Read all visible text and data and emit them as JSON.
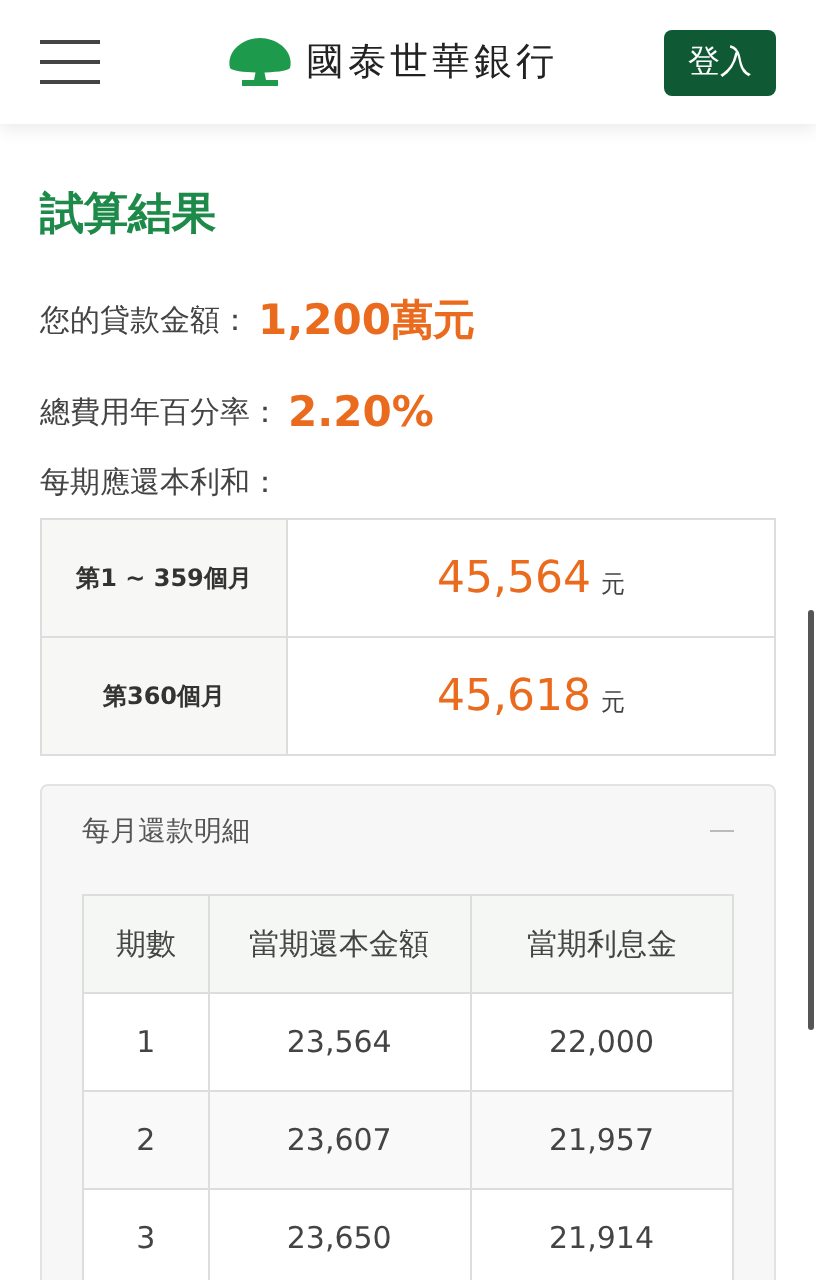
{
  "header": {
    "brand": "國泰世華銀行",
    "login_button": "登入"
  },
  "title": "試算結果",
  "summary": [
    {
      "label": "您的貸款金額：",
      "value": "1,200萬元"
    },
    {
      "label": "總費用年百分率：",
      "value": "2.20%"
    }
  ],
  "payment_label": "每期應還本利和：",
  "payments": [
    {
      "period": "第1 ~ 359個月",
      "amount": "45,564",
      "unit": "元"
    },
    {
      "period": "第360個月",
      "amount": "45,618",
      "unit": "元"
    }
  ],
  "detail_panel": {
    "title": "每月還款明細",
    "expanded": true,
    "columns": [
      "期數",
      "當期還本金額",
      "當期利息金"
    ],
    "rows": [
      [
        "1",
        "23,564",
        "22,000"
      ],
      [
        "2",
        "23,607",
        "21,957"
      ],
      [
        "3",
        "23,650",
        "21,914"
      ]
    ]
  }
}
